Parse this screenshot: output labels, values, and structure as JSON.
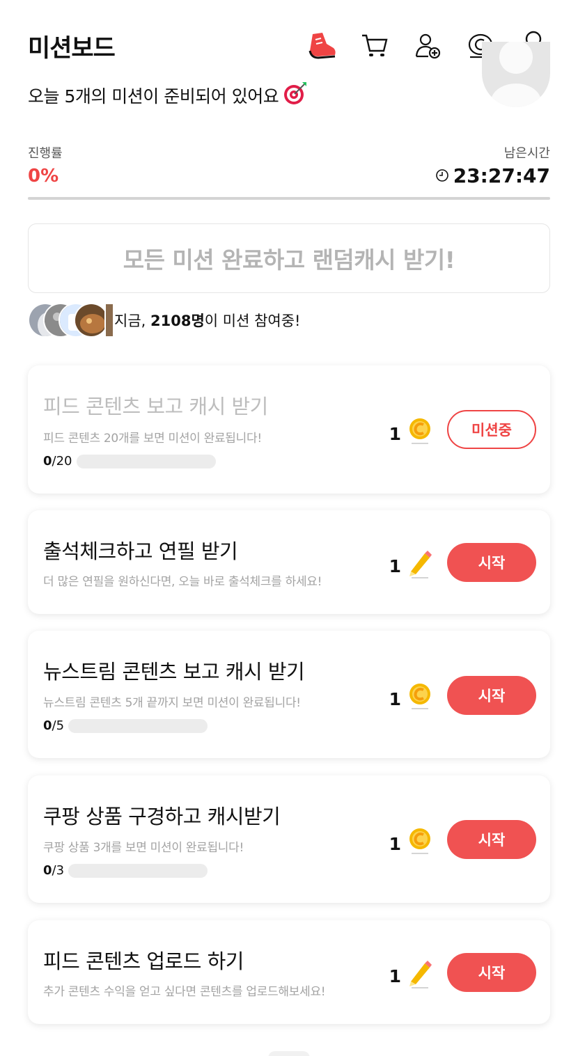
{
  "header": {
    "title": "미션보드",
    "icons": [
      "sneaker-icon",
      "cart-icon",
      "add-friend-icon",
      "coin-icon",
      "profile-icon"
    ]
  },
  "subtitle": {
    "text": "오늘 5개의 미션이 준비되어 있어요",
    "emoji": "🎯"
  },
  "progress": {
    "label": "진행률",
    "value_text": "0%",
    "fraction": 0,
    "remaining_label": "남은시간",
    "remaining_time": "23:27:47"
  },
  "banner": {
    "text": "모든 미션 완료하고 랜덤캐시 받기!"
  },
  "participants": {
    "prefix": "지금, ",
    "count": "2108명",
    "suffix": "이 미션 참여중!"
  },
  "missions": [
    {
      "title": "피드 콘텐츠 보고 캐시 받기",
      "desc": "피드 콘텐츠 20개를 보면 미션이 완료됩니다!",
      "done": "0",
      "total": "/20",
      "fraction": 0,
      "reward": "1",
      "reward_icon": "coin-icon",
      "button": "미션중",
      "state": "ongoing"
    },
    {
      "title": "출석체크하고 연필 받기",
      "desc": "더 많은 연필을 원하신다면, 오늘 바로 출석체크를 하세요!",
      "reward": "1",
      "reward_icon": "pencil-icon",
      "button": "시작",
      "state": "start"
    },
    {
      "title": "뉴스트림 콘텐츠 보고 캐시 받기",
      "desc": "뉴스트림 콘텐츠 5개 끝까지 보면 미션이 완료됩니다!",
      "done": "0",
      "total": "/5",
      "fraction": 0,
      "reward": "1",
      "reward_icon": "coin-icon",
      "button": "시작",
      "state": "start"
    },
    {
      "title": "쿠팡 상품 구경하고 캐시받기",
      "desc": "쿠팡 상품 3개를 보면 미션이 완료됩니다!",
      "done": "0",
      "total": "/3",
      "fraction": 0,
      "reward": "1",
      "reward_icon": "coin-icon",
      "button": "시작",
      "state": "start"
    },
    {
      "title": "피드 콘텐츠 업로드 하기",
      "desc": "추가 콘텐츠 수익을 얻고 싶다면 콘텐츠를 업로드해보세요!",
      "reward": "1",
      "reward_icon": "pencil-icon",
      "button": "시작",
      "state": "start"
    }
  ],
  "colors": {
    "accent": "#ef4444",
    "button": "#f05252",
    "coin": "#f5b800",
    "muted_text": "#a3a3a3"
  }
}
